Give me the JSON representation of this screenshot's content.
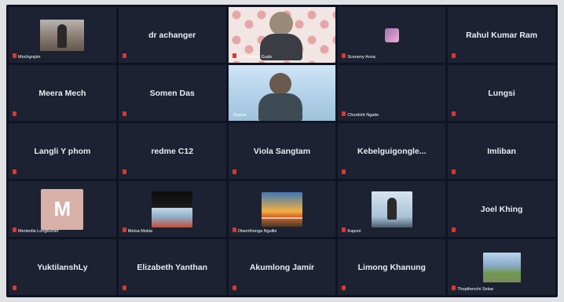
{
  "meeting": {
    "tiles": [
      {
        "type": "photo",
        "cap": "Mochgrajim"
      },
      {
        "type": "name",
        "name": "dr achanger"
      },
      {
        "type": "video",
        "cap": "Christopher Gudo"
      },
      {
        "type": "mini",
        "cap": "Sceneny Anna"
      },
      {
        "type": "name",
        "name": "Rahul Kumar Ram"
      },
      {
        "type": "name",
        "name": "Meera Mech"
      },
      {
        "type": "name",
        "name": "Somen Das"
      },
      {
        "type": "video-room",
        "cap": "Sophia"
      },
      {
        "type": "name",
        "cap": "Chunbirb Ngaite"
      },
      {
        "type": "name",
        "name": "Lungsi"
      },
      {
        "type": "name",
        "name": "Langli Y phom"
      },
      {
        "type": "name",
        "name": "redme C12"
      },
      {
        "type": "name",
        "name": "Viola Sangtam"
      },
      {
        "type": "name",
        "name": "Kebelguigongle..."
      },
      {
        "type": "name",
        "name": "Imliban"
      },
      {
        "type": "avatar",
        "letter": "M",
        "cap": "Mertenlla Longkumer"
      },
      {
        "type": "photo2",
        "cap": "Metsa Mokia"
      },
      {
        "type": "photo3",
        "cap": "Otsenthonga Ngullie"
      },
      {
        "type": "photo4",
        "cap": "Kapuni"
      },
      {
        "type": "name",
        "name": "Joel Khing"
      },
      {
        "type": "name",
        "name": "YuktilanshLy"
      },
      {
        "type": "name",
        "name": "Elizabeth Yanthan"
      },
      {
        "type": "name",
        "name": "Akumlong Jamir"
      },
      {
        "type": "name",
        "name": "Limong Khanung"
      },
      {
        "type": "photo5",
        "cap": "Thopthenchi Sekar"
      }
    ]
  }
}
